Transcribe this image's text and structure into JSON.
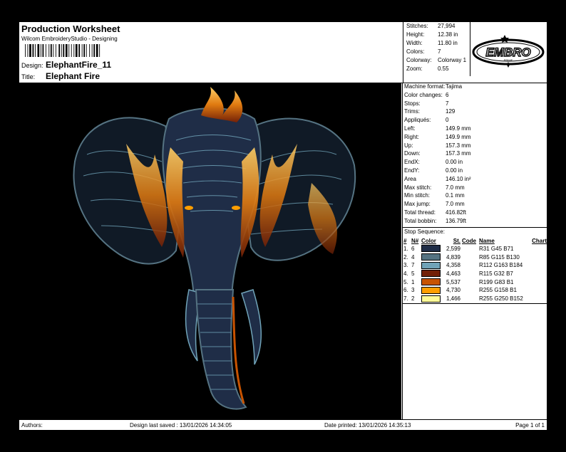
{
  "header": {
    "title": "Production Worksheet",
    "subtitle": "Wilcom EmbroideryStudio - Designing",
    "design_label": "Design:",
    "design_value": "ElephantFire_11",
    "title_label": "Title:",
    "title_value": "Elephant Fire"
  },
  "summary": [
    {
      "label": "Stitches:",
      "value": "27,994"
    },
    {
      "label": "Height:",
      "value": "12.38 in"
    },
    {
      "label": "Width:",
      "value": "11.80 in"
    },
    {
      "label": "Colors:",
      "value": "7"
    },
    {
      "label": "Colorway:",
      "value": "Colorway 1"
    },
    {
      "label": "Zoom:",
      "value": "0.55"
    }
  ],
  "logo": {
    "text": "EMBRO",
    "subtext": "PRIME"
  },
  "machine": [
    {
      "label": "Machine format:",
      "value": "Tajima"
    },
    {
      "label": "Color changes:",
      "value": "6"
    },
    {
      "label": "Stops:",
      "value": "7"
    },
    {
      "label": "Trims:",
      "value": "129"
    },
    {
      "label": "Appliqués:",
      "value": "0"
    },
    {
      "label": "Left:",
      "value": "149.9 mm"
    },
    {
      "label": "Right:",
      "value": "149.9 mm"
    },
    {
      "label": "Up:",
      "value": "157.3 mm"
    },
    {
      "label": "Down:",
      "value": "157.3 mm"
    },
    {
      "label": "EndX:",
      "value": "0.00 in"
    },
    {
      "label": "EndY:",
      "value": "0.00 in"
    },
    {
      "label": "Area",
      "value": "146.10 in²"
    },
    {
      "label": "Max stitch:",
      "value": "7.0 mm"
    },
    {
      "label": "Min stitch:",
      "value": "0.1 mm"
    },
    {
      "label": "Max jump:",
      "value": "7.0 mm"
    },
    {
      "label": "Total thread:",
      "value": "416.82ft"
    },
    {
      "label": "Total bobbin:",
      "value": "136.79ft"
    }
  ],
  "stop_sequence": {
    "title": "Stop Sequence:",
    "headers": [
      "#",
      "N#",
      "Color",
      "St.",
      "Code",
      "Name",
      "Chart"
    ],
    "rows": [
      {
        "idx": "1.",
        "n": "6",
        "color": "#1f2d47",
        "st": "2,599",
        "code": "",
        "name": "R31 G45 B71",
        "chart": ""
      },
      {
        "idx": "2.",
        "n": "4",
        "color": "#557382",
        "st": "4,839",
        "code": "",
        "name": "R85 G115 B130",
        "chart": ""
      },
      {
        "idx": "3.",
        "n": "7",
        "color": "#70a3b8",
        "st": "4,358",
        "code": "",
        "name": "R112 G163 B184",
        "chart": ""
      },
      {
        "idx": "4.",
        "n": "5",
        "color": "#732007",
        "st": "4,463",
        "code": "",
        "name": "R115 G32 B7",
        "chart": ""
      },
      {
        "idx": "5.",
        "n": "1",
        "color": "#c75301",
        "st": "5,537",
        "code": "",
        "name": "R199 G83 B1",
        "chart": ""
      },
      {
        "idx": "6.",
        "n": "3",
        "color": "#ff9e01",
        "st": "4,730",
        "code": "",
        "name": "R255 G158 B1",
        "chart": ""
      },
      {
        "idx": "7.",
        "n": "2",
        "color": "#fffa98",
        "st": "1,466",
        "code": "",
        "name": "R255 G250 B152",
        "chart": ""
      }
    ]
  },
  "footer": {
    "authors": "Authors:",
    "saved": "Design last saved : 13/01/2026 14:34:05",
    "printed": "Date printed: 13/01/2026 14:35:13",
    "page": "Page 1 of 1"
  }
}
